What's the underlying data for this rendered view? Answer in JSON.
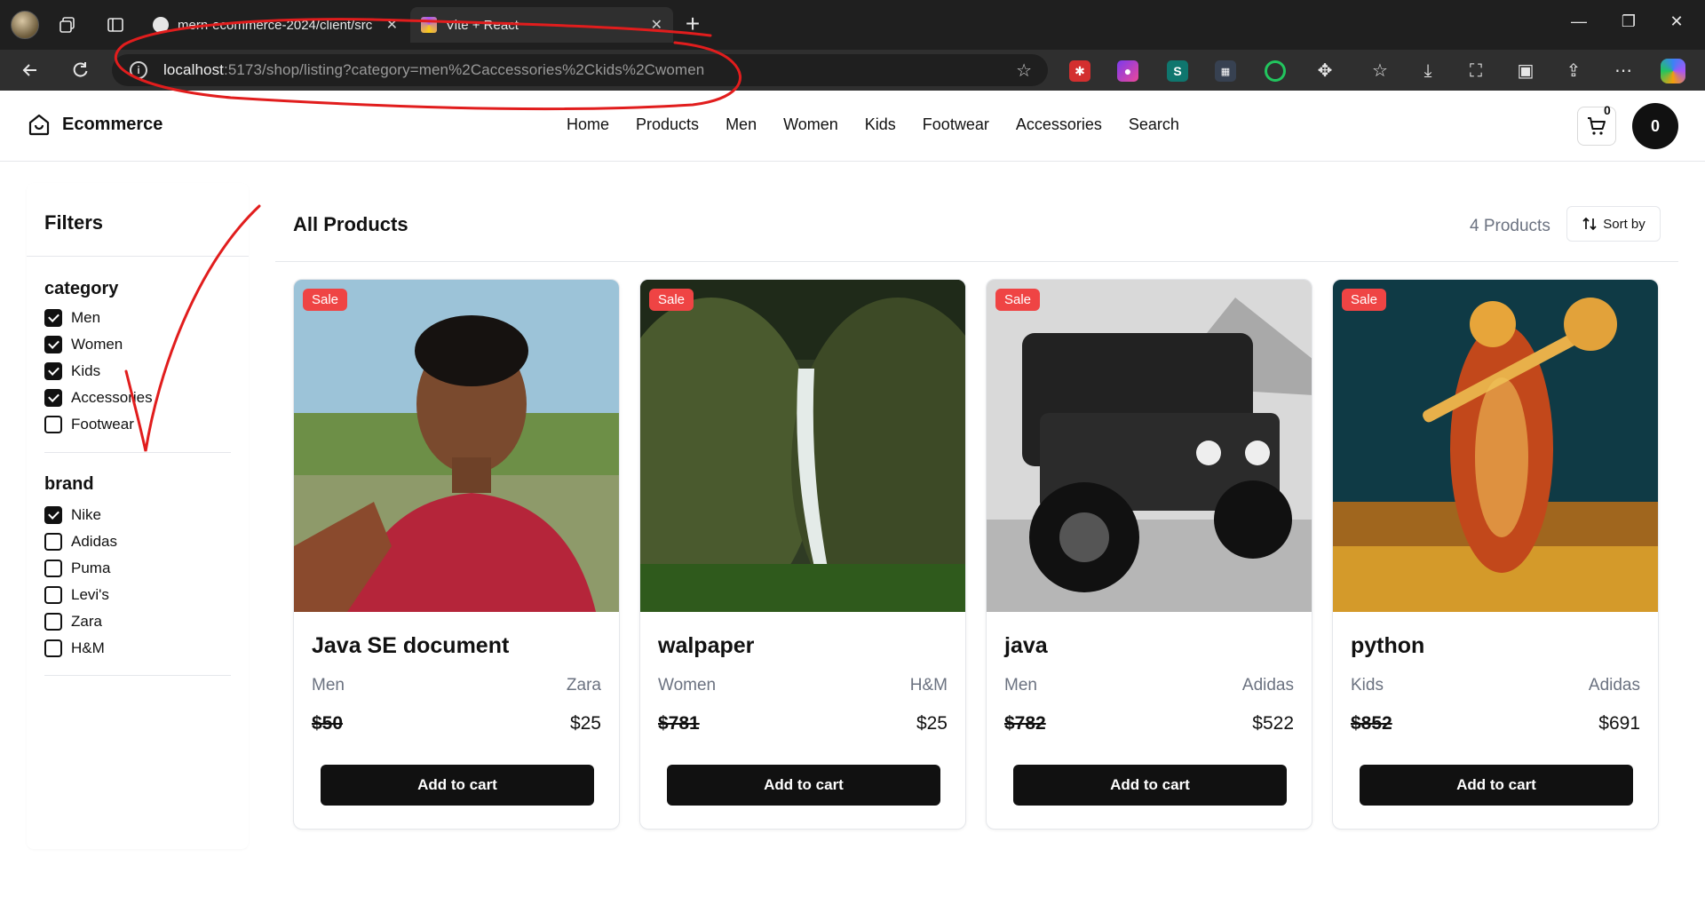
{
  "browser": {
    "tabs": [
      {
        "title": "mern-ecommerce-2024/client/src",
        "active": false
      },
      {
        "title": "Vite + React",
        "active": true
      }
    ],
    "url_host": "localhost",
    "url_rest": ":5173/shop/listing?category=men%2Caccessories%2Ckids%2Cwomen",
    "window_controls": {
      "minimize": "—",
      "restore": "❐",
      "close": "✕"
    }
  },
  "header": {
    "brand": "Ecommerce",
    "menu": [
      "Home",
      "Products",
      "Men",
      "Women",
      "Kids",
      "Footwear",
      "Accessories",
      "Search"
    ],
    "cart_count": "0",
    "avatar_initial": "0"
  },
  "filters": {
    "title": "Filters",
    "groups": [
      {
        "title": "category",
        "options": [
          {
            "label": "Men",
            "checked": true
          },
          {
            "label": "Women",
            "checked": true
          },
          {
            "label": "Kids",
            "checked": true
          },
          {
            "label": "Accessories",
            "checked": true
          },
          {
            "label": "Footwear",
            "checked": false
          }
        ]
      },
      {
        "title": "brand",
        "options": [
          {
            "label": "Nike",
            "checked": true
          },
          {
            "label": "Adidas",
            "checked": false
          },
          {
            "label": "Puma",
            "checked": false
          },
          {
            "label": "Levi's",
            "checked": false
          },
          {
            "label": "Zara",
            "checked": false
          },
          {
            "label": "H&M",
            "checked": false
          }
        ]
      }
    ]
  },
  "listing": {
    "title": "All Products",
    "count_label": "4 Products",
    "sort_label": "Sort by",
    "products": [
      {
        "name": "Java SE document",
        "category": "Men",
        "brand": "Zara",
        "price": "$50",
        "sale_price": "$25",
        "badge": "Sale",
        "button": "Add to cart"
      },
      {
        "name": "walpaper",
        "category": "Women",
        "brand": "H&M",
        "price": "$781",
        "sale_price": "$25",
        "badge": "Sale",
        "button": "Add to cart"
      },
      {
        "name": "java",
        "category": "Men",
        "brand": "Adidas",
        "price": "$782",
        "sale_price": "$522",
        "badge": "Sale",
        "button": "Add to cart"
      },
      {
        "name": "python",
        "category": "Kids",
        "brand": "Adidas",
        "price": "$852",
        "sale_price": "$691",
        "badge": "Sale",
        "button": "Add to cart"
      }
    ]
  },
  "colors": {
    "accent": "#111111",
    "sale": "#ef4444",
    "annotation": "#e11d1d"
  }
}
